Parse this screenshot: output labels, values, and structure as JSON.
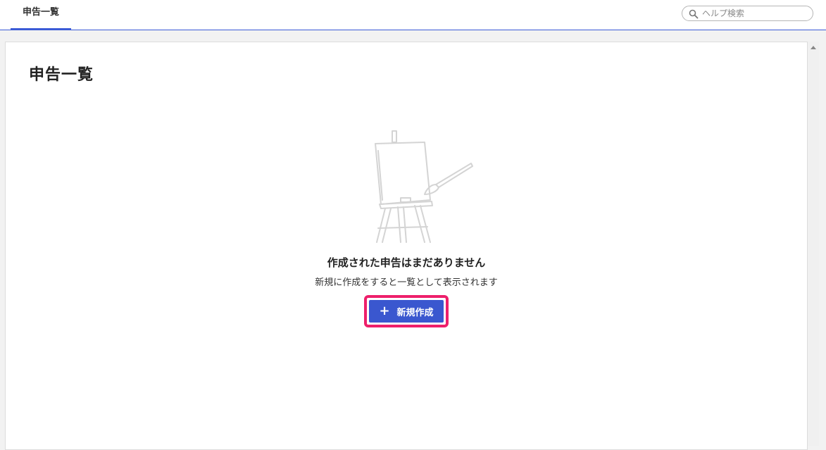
{
  "header": {
    "tab_label": "申告一覧",
    "search": {
      "placeholder": "ヘルプ検索",
      "value": ""
    }
  },
  "main": {
    "page_title": "申告一覧",
    "empty_state": {
      "title": "作成された申告はまだありません",
      "description": "新規に作成をすると一覧として表示されます",
      "illustration_icon": "easel-paintbrush-icon"
    },
    "create_button": {
      "label": "新規作成",
      "icon": "plus-icon"
    }
  },
  "colors": {
    "accent": "#3a57cf",
    "highlight": "#ee1f6b",
    "tab_underline": "#3b5bd6"
  }
}
